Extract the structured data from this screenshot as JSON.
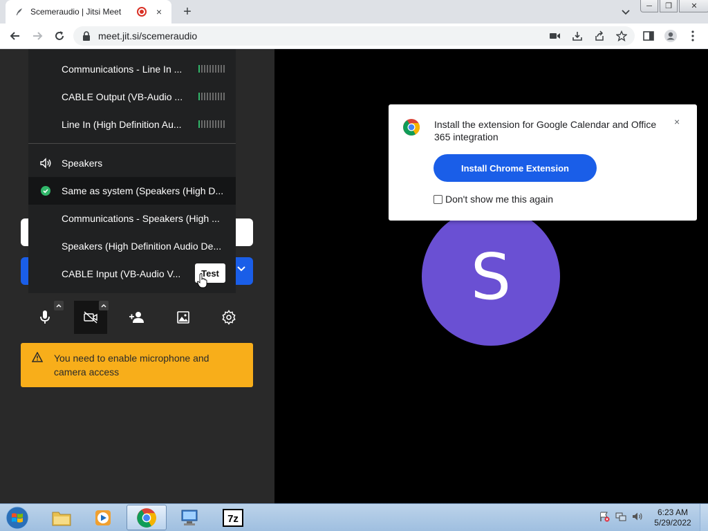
{
  "browser": {
    "tab_title": "Scemeraudio | Jitsi Meet",
    "tab_close": "×",
    "new_tab": "+",
    "url": "meet.jit.si/scemeraudio"
  },
  "window_controls": {
    "minimize": "─",
    "restore": "❐",
    "close": "✕"
  },
  "audio_menu": {
    "microphones": [
      {
        "label": "Communications - Line In ...",
        "level": 0.1
      },
      {
        "label": "CABLE Output (VB-Audio ...",
        "level": 0.1
      },
      {
        "label": "Line In (High Definition Au...",
        "level": 0.1
      }
    ],
    "speakers_header": "Speakers",
    "speakers": [
      {
        "label": "Same as system (Speakers (High D...",
        "selected": true
      },
      {
        "label": "Communications - Speakers (High ...",
        "selected": false
      },
      {
        "label": "Speakers (High Definition Audio De...",
        "selected": false
      },
      {
        "label": "CABLE Input (VB-Audio V...",
        "selected": false
      }
    ],
    "test_label": "Test"
  },
  "controls": [
    "microphone-icon",
    "video-off-icon",
    "invite-icon",
    "background-icon",
    "settings-icon"
  ],
  "warning": {
    "text": "You need to enable microphone and camera access"
  },
  "avatar": {
    "initial": "S",
    "color": "#6a50d3"
  },
  "extension_popup": {
    "message": "Install the extension for Google Calendar and Office 365 integration",
    "close": "×",
    "install_label": "Install Chrome Extension",
    "dont_show_label": "Don't show me this again"
  },
  "colors": {
    "primary": "#1a5ee8",
    "warning": "#f8ae1a",
    "success": "#31b76a"
  },
  "taskbar": {
    "apps": [
      "explorer-icon",
      "media-player-icon",
      "chrome-icon",
      "network-icon",
      "7zip-icon"
    ],
    "sevenzip_label": "7z",
    "time": "6:23 AM",
    "date": "5/29/2022"
  }
}
